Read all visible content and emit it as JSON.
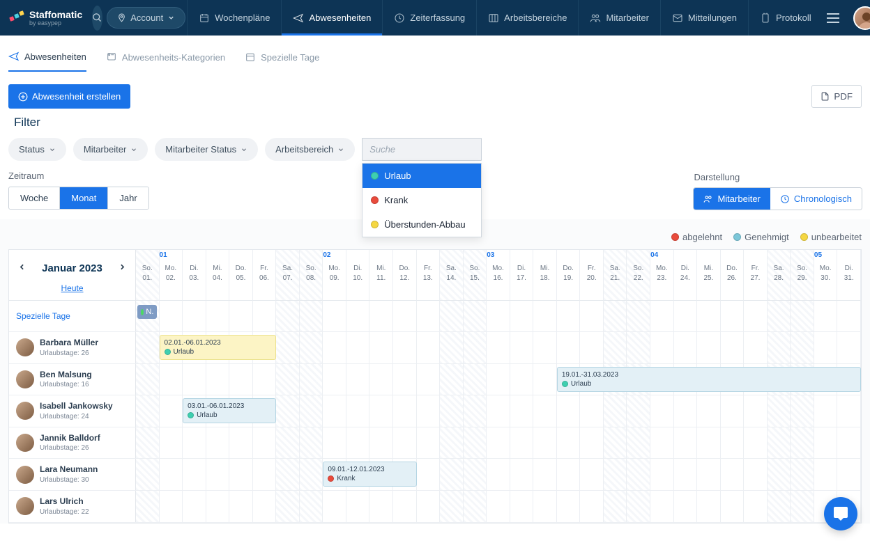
{
  "logo": {
    "name": "Staffomatic",
    "sub": "by easypep"
  },
  "nav": {
    "account": "Account",
    "items": [
      "Wochenpläne",
      "Abwesenheiten",
      "Zeiterfassung",
      "Arbeitsbereiche",
      "Mitarbeiter",
      "Mitteilungen",
      "Protokoll"
    ],
    "activeIndex": 1
  },
  "subtabs": {
    "items": [
      "Abwesenheiten",
      "Abwesenheits-Kategorien",
      "Spezielle Tage"
    ],
    "activeIndex": 0
  },
  "buttons": {
    "create": "Abwesenheit erstellen",
    "pdf": "PDF"
  },
  "filter": {
    "title": "Filter",
    "pills": [
      "Status",
      "Mitarbeiter",
      "Mitarbeiter Status",
      "Arbeitsbereich"
    ],
    "searchPlaceholder": "Suche",
    "dropdown": [
      {
        "label": "Urlaub",
        "color": "#3ecfb0",
        "selected": true
      },
      {
        "label": "Krank",
        "color": "#e94b3c",
        "selected": false
      },
      {
        "label": "Überstunden-Abbau",
        "color": "#f5d742",
        "selected": false
      }
    ]
  },
  "period": {
    "label": "Zeitraum",
    "segs": [
      "Woche",
      "Monat",
      "Jahr"
    ],
    "activeIndex": 1
  },
  "display": {
    "label": "Darstellung",
    "segs": [
      "Mitarbeiter",
      "Chronologisch"
    ],
    "activeIndex": 0
  },
  "legend": [
    {
      "label": "abgelehnt",
      "color": "#e94b3c"
    },
    {
      "label": "Genehmigt",
      "color": "#7cc7d9"
    },
    {
      "label": "unbearbeitet",
      "color": "#f5d742"
    }
  ],
  "calendar": {
    "title": "Januar 2023",
    "today": "Heute",
    "specialRow": "Spezielle Tage",
    "specialBadge": "N.",
    "weeks": [
      "01",
      "02",
      "03",
      "04",
      "05"
    ],
    "days": [
      {
        "d": "So.",
        "n": "01.",
        "w": true
      },
      {
        "d": "Mo.",
        "n": "02."
      },
      {
        "d": "Di.",
        "n": "03."
      },
      {
        "d": "Mi.",
        "n": "04."
      },
      {
        "d": "Do.",
        "n": "05."
      },
      {
        "d": "Fr.",
        "n": "06."
      },
      {
        "d": "Sa.",
        "n": "07.",
        "w": true
      },
      {
        "d": "So.",
        "n": "08.",
        "w": true
      },
      {
        "d": "Mo.",
        "n": "09."
      },
      {
        "d": "Di.",
        "n": "10."
      },
      {
        "d": "Mi.",
        "n": "11."
      },
      {
        "d": "Do.",
        "n": "12."
      },
      {
        "d": "Fr.",
        "n": "13."
      },
      {
        "d": "Sa.",
        "n": "14.",
        "w": true
      },
      {
        "d": "So.",
        "n": "15.",
        "w": true
      },
      {
        "d": "Mo.",
        "n": "16."
      },
      {
        "d": "Di.",
        "n": "17."
      },
      {
        "d": "Mi.",
        "n": "18."
      },
      {
        "d": "Do.",
        "n": "19."
      },
      {
        "d": "Fr.",
        "n": "20."
      },
      {
        "d": "Sa.",
        "n": "21.",
        "w": true
      },
      {
        "d": "So.",
        "n": "22.",
        "w": true
      },
      {
        "d": "Mo.",
        "n": "23."
      },
      {
        "d": "Di.",
        "n": "24."
      },
      {
        "d": "Mi.",
        "n": "25."
      },
      {
        "d": "Do.",
        "n": "26."
      },
      {
        "d": "Fr.",
        "n": "27."
      },
      {
        "d": "Sa.",
        "n": "28.",
        "w": true
      },
      {
        "d": "So.",
        "n": "29.",
        "w": true
      },
      {
        "d": "Mo.",
        "n": "30."
      },
      {
        "d": "Di.",
        "n": "31."
      }
    ]
  },
  "employees": [
    {
      "name": "Barbara Müller",
      "sub": "Urlaubstage: 26",
      "absences": [
        {
          "start": 1,
          "span": 5,
          "range": "02.01.-06.01.2023",
          "tag": "Urlaub",
          "color": "#3ecfb0",
          "style": "yellow"
        }
      ]
    },
    {
      "name": "Ben Malsung",
      "sub": "Urlaubstage: 16",
      "absences": [
        {
          "start": 18,
          "span": 13,
          "range": "19.01.-31.03.2023",
          "tag": "Urlaub",
          "color": "#3ecfb0",
          "style": "blue"
        }
      ]
    },
    {
      "name": "Isabell Jankowsky",
      "sub": "Urlaubstage: 24",
      "absences": [
        {
          "start": 2,
          "span": 4,
          "range": "03.01.-06.01.2023",
          "tag": "Urlaub",
          "color": "#3ecfb0",
          "style": "blue"
        }
      ]
    },
    {
      "name": "Jannik Balldorf",
      "sub": "Urlaubstage: 26",
      "absences": []
    },
    {
      "name": "Lara Neumann",
      "sub": "Urlaubstage: 30",
      "absences": [
        {
          "start": 8,
          "span": 4,
          "range": "09.01.-12.01.2023",
          "tag": "Krank",
          "color": "#e94b3c",
          "style": "blue"
        }
      ]
    },
    {
      "name": "Lars Ulrich",
      "sub": "Urlaubstage: 22",
      "absences": []
    }
  ]
}
